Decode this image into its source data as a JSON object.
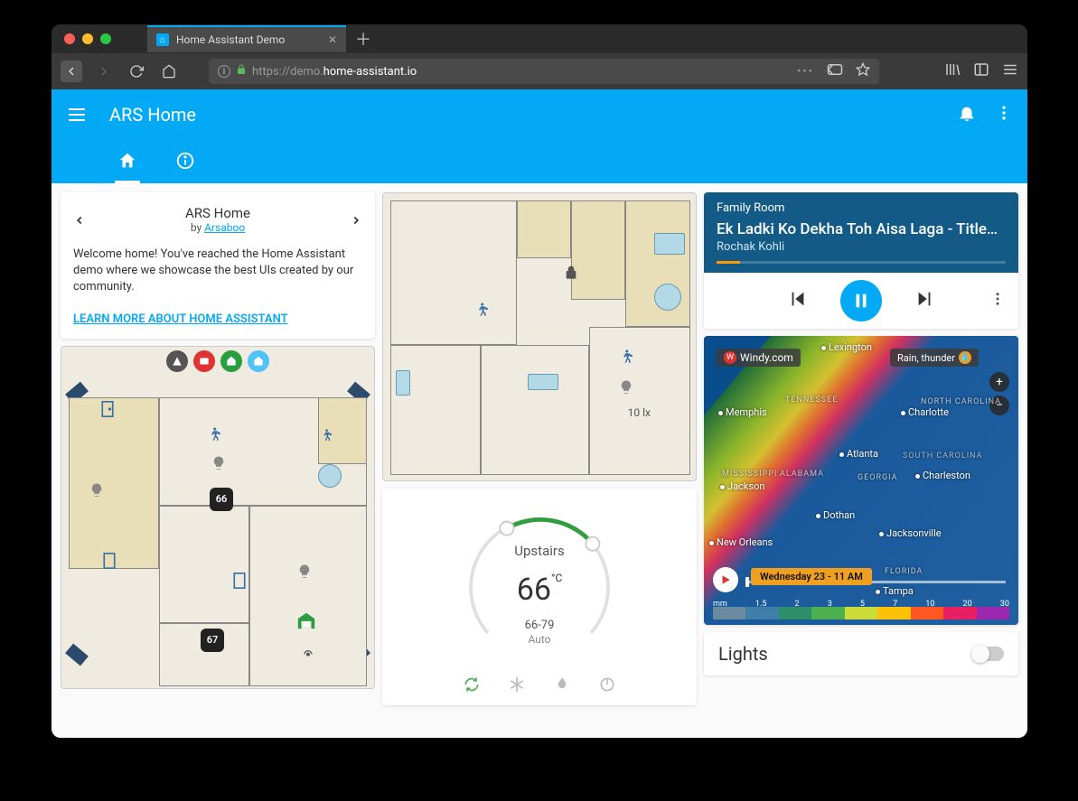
{
  "browser": {
    "tab_title": "Home Assistant Demo",
    "url_display": "https://demo.home-assistant.io",
    "url_host": "home-assistant.io",
    "url_prefix": "https://demo."
  },
  "header": {
    "title": "ARS Home"
  },
  "welcome": {
    "title": "ARS Home",
    "by_prefix": "by ",
    "author": "Arsaboo",
    "body": "Welcome home! You've reached the Home Assistant demo where we showcase the best UIs created by our community.",
    "link": "LEARN MORE ABOUT HOME ASSISTANT"
  },
  "floorplan_upper": {
    "light_level": "10 lx"
  },
  "floorplan_main": {
    "temp_badges": [
      "66",
      "67"
    ]
  },
  "thermostat": {
    "name": "Upstairs",
    "temp": "66",
    "unit": "°C",
    "range": "66-79",
    "mode": "Auto"
  },
  "media": {
    "room": "Family Room",
    "title": "Ek Ladki Ko Dekha Toh Aisa Laga - Title…",
    "artist": "Rochak Kohli"
  },
  "weather": {
    "provider": "Windy.com",
    "layer": "Rain, thunder",
    "timestamp": "Wednesday 23 - 11 AM",
    "scale_unit": "mm",
    "scale_values": [
      "1.5",
      "2",
      "3",
      "5",
      "7",
      "10",
      "20",
      "30"
    ],
    "cities": [
      "Lexington",
      "Memphis",
      "Charlotte",
      "Atlanta",
      "Charleston",
      "Jackson",
      "Dothan",
      "New Orleans",
      "Jacksonville",
      "Tampa"
    ],
    "regions": [
      "TENNESSEE",
      "NORTH CAROLINA",
      "MISSISSIPPI",
      "ALABAMA",
      "GEORGIA",
      "SOUTH CAROLINA",
      "FLORIDA"
    ]
  },
  "lights": {
    "title": "Lights"
  }
}
